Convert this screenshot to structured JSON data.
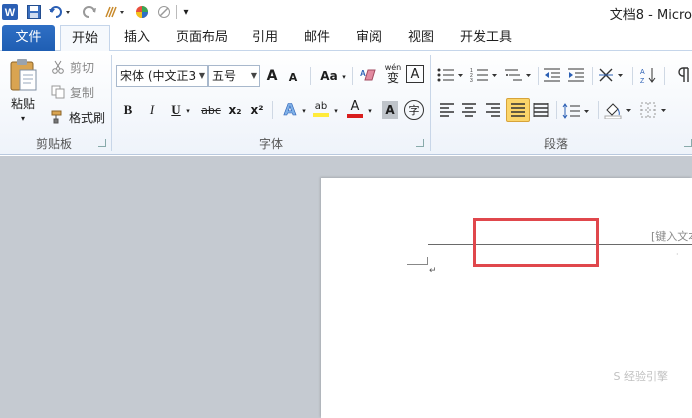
{
  "window": {
    "title": "文档8 - Micro"
  },
  "qat": {
    "customize_glyph": "▾"
  },
  "tabs": [
    {
      "id": "file",
      "label": "文件"
    },
    {
      "id": "home",
      "label": "开始"
    },
    {
      "id": "insert",
      "label": "插入"
    },
    {
      "id": "layout",
      "label": "页面布局"
    },
    {
      "id": "references",
      "label": "引用"
    },
    {
      "id": "mailings",
      "label": "邮件"
    },
    {
      "id": "review",
      "label": "审阅"
    },
    {
      "id": "view",
      "label": "视图"
    },
    {
      "id": "developer",
      "label": "开发工具"
    }
  ],
  "clipboard": {
    "paste_label": "粘贴",
    "cut_label": "剪切",
    "copy_label": "复制",
    "format_painter_label": "格式刷",
    "group_label": "剪贴板"
  },
  "font": {
    "font_name": "宋体 (中文正3",
    "font_size": "五号",
    "grow_label": "A",
    "shrink_label": "A",
    "case_label": "Aa",
    "pinyin_label": "wén",
    "pinyin_char": "变",
    "border_char": "A",
    "bold": "B",
    "italic": "I",
    "underline": "U",
    "strike": "abc",
    "subscript": "x₂",
    "superscript": "x²",
    "effects": "A",
    "highlight": "ab",
    "color": "A",
    "shading": "A",
    "enclose": "字",
    "group_label": "字体"
  },
  "paragraph": {
    "group_label": "段落"
  },
  "document": {
    "header_placeholder": "[键入文本",
    "para_mark": "↵"
  },
  "watermark": "S 经验引擎",
  "colors": {
    "file_tab": "#2a66bd",
    "highlight_box": "#e0474c",
    "canvas_bg": "#c5cad1",
    "font_color": "#d81e1e",
    "highlight_color": "#ffeb3b"
  }
}
